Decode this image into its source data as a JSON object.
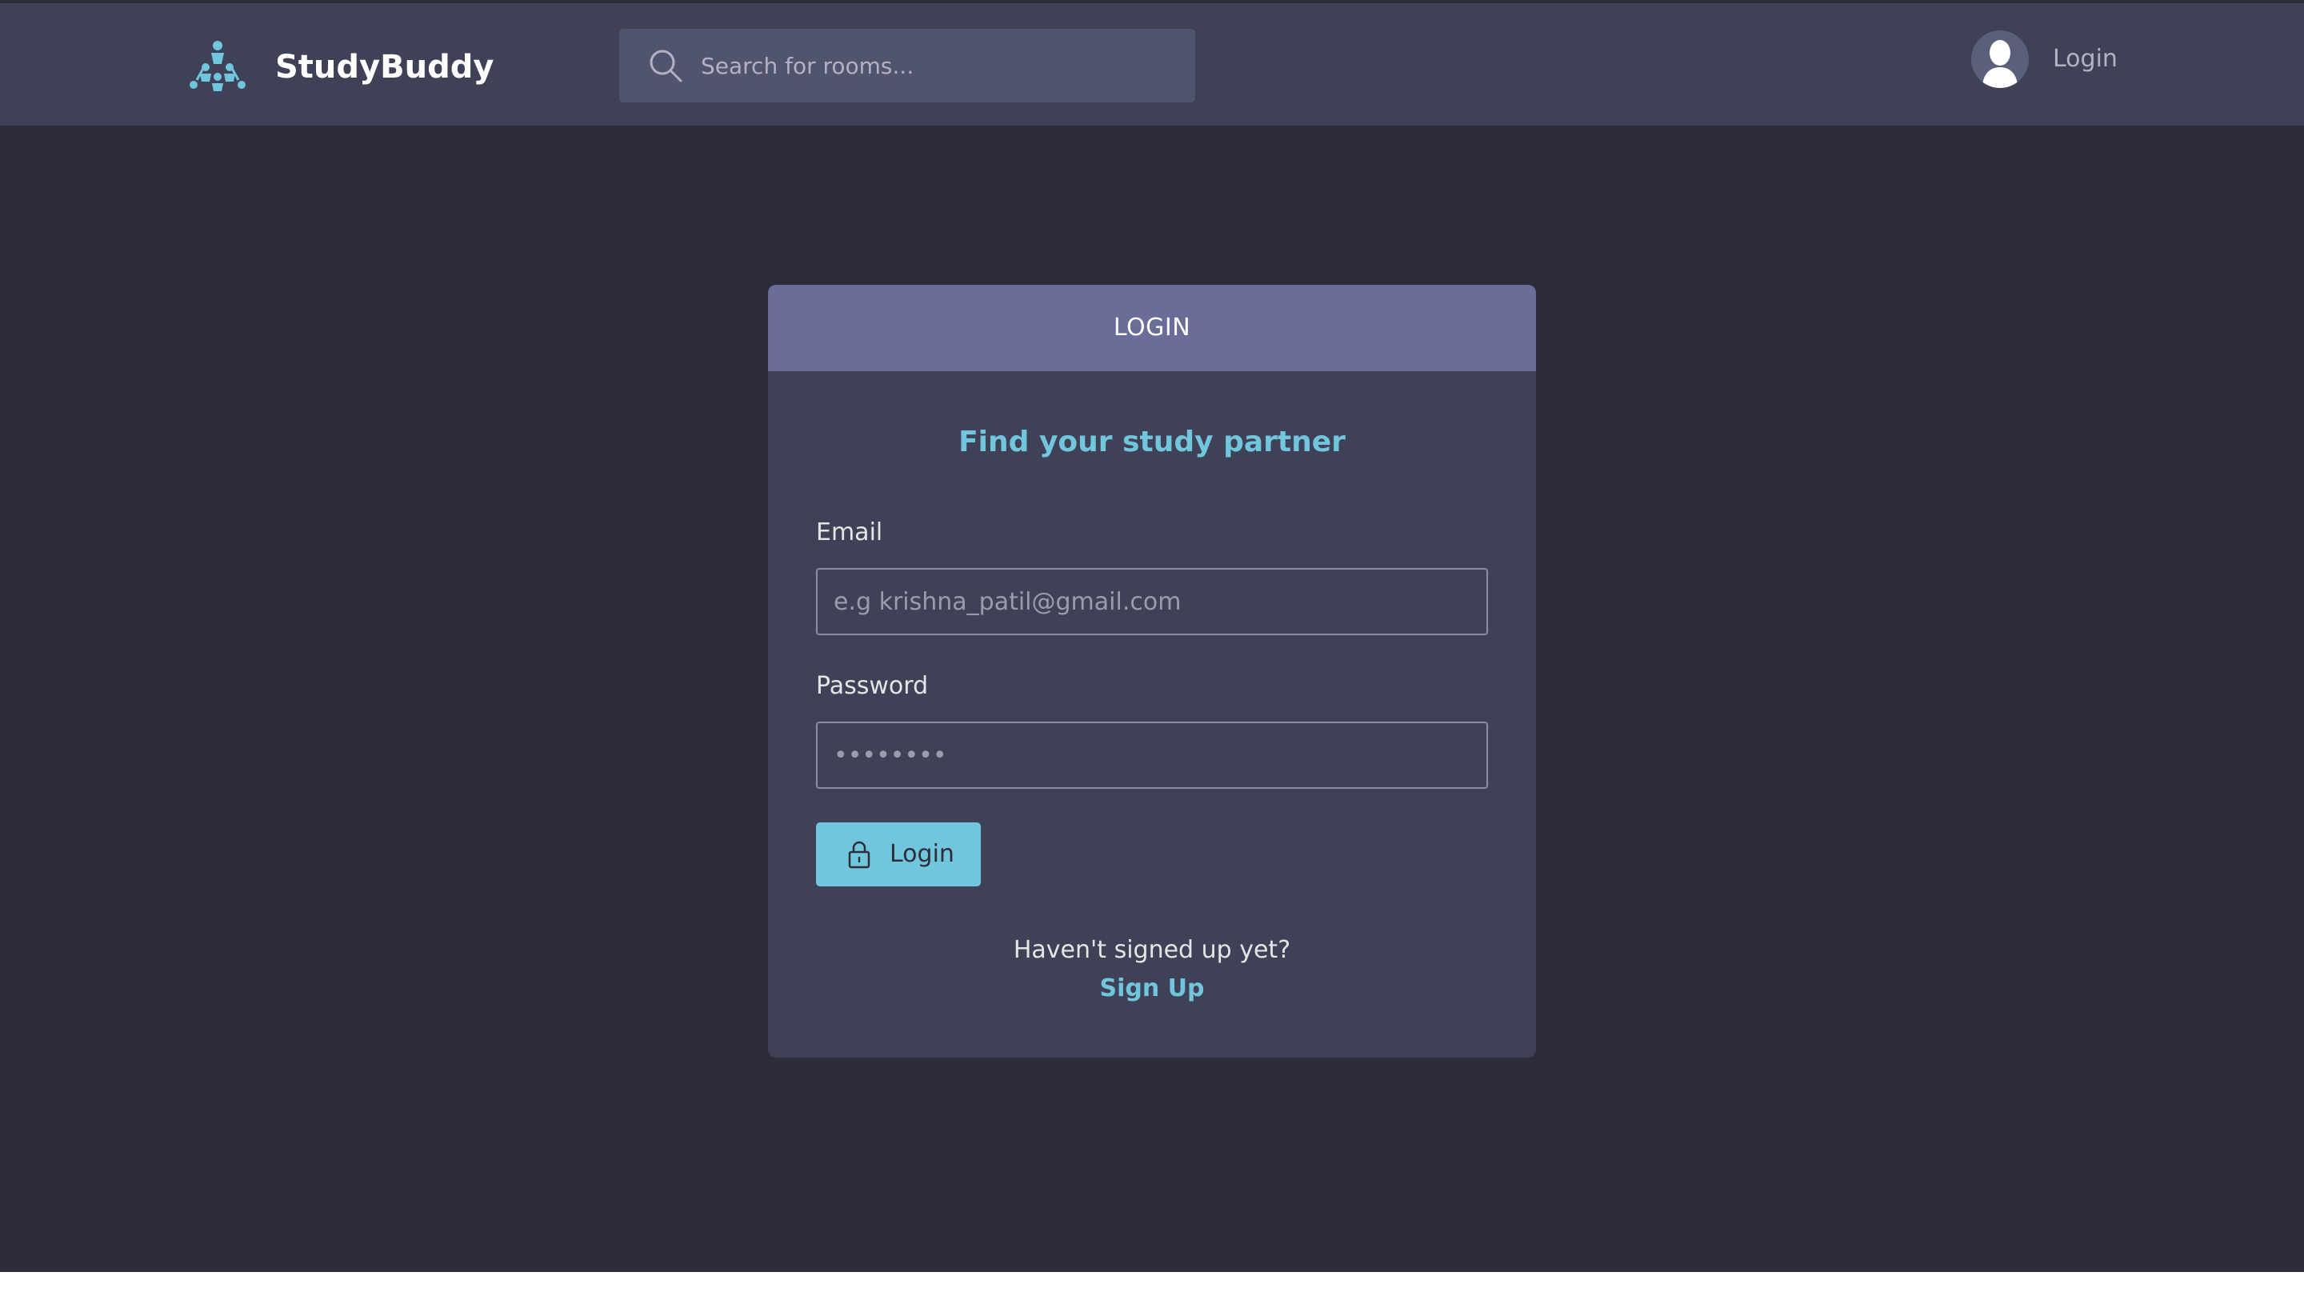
{
  "header": {
    "brand": "StudyBuddy",
    "search_placeholder": "Search for rooms...",
    "login_label": "Login"
  },
  "login_card": {
    "title": "LOGIN",
    "subtitle": "Find your study partner",
    "email_label": "Email",
    "email_placeholder": "e.g krishna_patil@gmail.com",
    "password_label": "Password",
    "password_placeholder": "••••••••",
    "login_button": "Login",
    "signup_prompt": "Haven't signed up yet?",
    "signup_link": "Sign Up"
  },
  "colors": {
    "background": "#2d2d39",
    "header": "#3f4156",
    "card_header": "#696d97",
    "accent": "#71c6dd"
  },
  "icons": {
    "logo": "people-network-icon",
    "search": "search-icon",
    "avatar": "user-avatar-icon",
    "lock": "lock-icon"
  }
}
